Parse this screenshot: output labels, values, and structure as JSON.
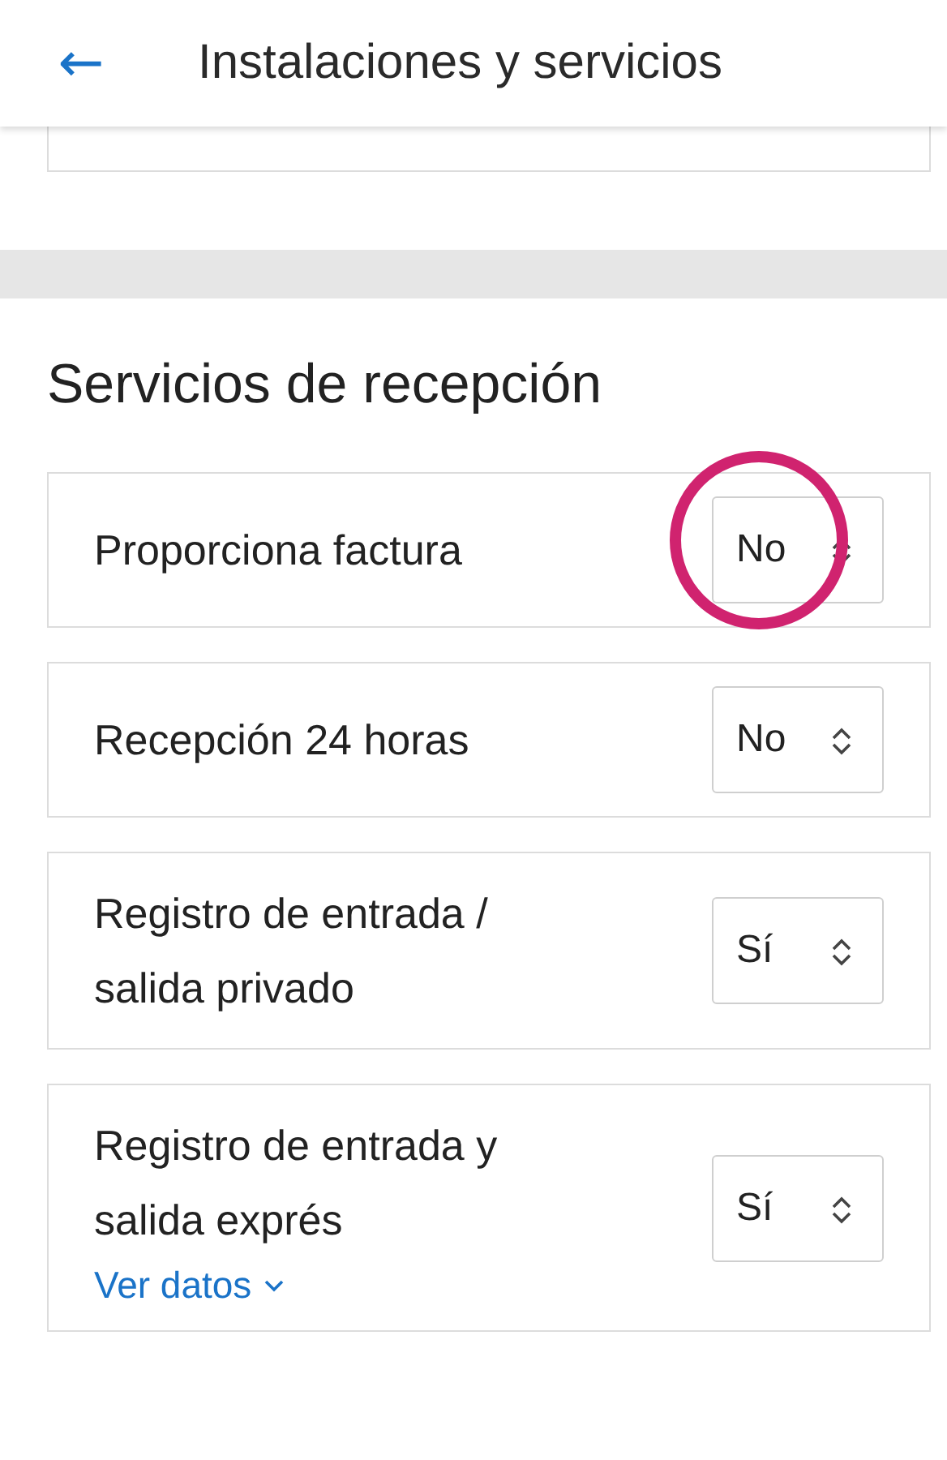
{
  "header": {
    "back_icon": "←",
    "title": "Instalaciones y servicios"
  },
  "section": {
    "title": "Servicios de recepción"
  },
  "rows": [
    {
      "label": "Proporciona factura",
      "value": "No",
      "highlighted": true
    },
    {
      "label": "Recepción 24 horas",
      "value": "No",
      "highlighted": false
    },
    {
      "label": "Registro de entrada / salida privado",
      "value": "Sí",
      "highlighted": false
    },
    {
      "label": "Registro de entrada y salida exprés",
      "value": "Sí",
      "highlighted": false,
      "link": "Ver datos"
    }
  ]
}
